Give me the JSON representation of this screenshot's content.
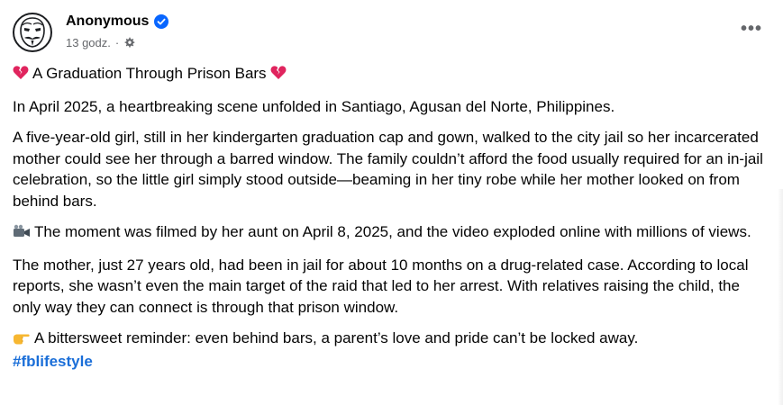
{
  "post": {
    "author": "Anonymous",
    "timestamp": "13 godz.",
    "separator": "·",
    "privacy_icon": "gear-icon",
    "verified_icon": "verified-badge-icon",
    "more_label": "•••",
    "title": "A Graduation Through Prison Bars",
    "title_emoji": "broken-heart-icon",
    "paragraphs": [
      "In April 2025, a heartbreaking scene unfolded in Santiago, Agusan del Norte, Philippines.",
      "A five-year-old girl, still in her kindergarten graduation cap and gown, walked to the city jail so her incarcerated mother could see her through a barred window. The family couldn’t afford the food usually required for an in-jail celebration, so the little girl simply stood outside—beaming in her tiny robe while her mother looked on from behind bars.",
      "The moment was filmed by her aunt on April 8, 2025, and the video exploded online with millions of views.",
      "The mother, just 27 years old, had been in jail for about 10 months on a drug-related case. According to local reports, she wasn’t even the main target of the raid that led to her arrest. With relatives raising the child, the only way they can connect is through that prison window.",
      "A bittersweet reminder: even behind bars, a parent’s love and pride can’t be locked away."
    ],
    "video_emoji": "video-camera-icon",
    "pointing_emoji": "pointing-hand-icon",
    "hashtag": "#fblifestyle"
  },
  "colors": {
    "text": "#050505",
    "secondary": "#65676b",
    "link": "#1a6ed8",
    "verified": "#0866ff",
    "heart": "#e0245e"
  }
}
